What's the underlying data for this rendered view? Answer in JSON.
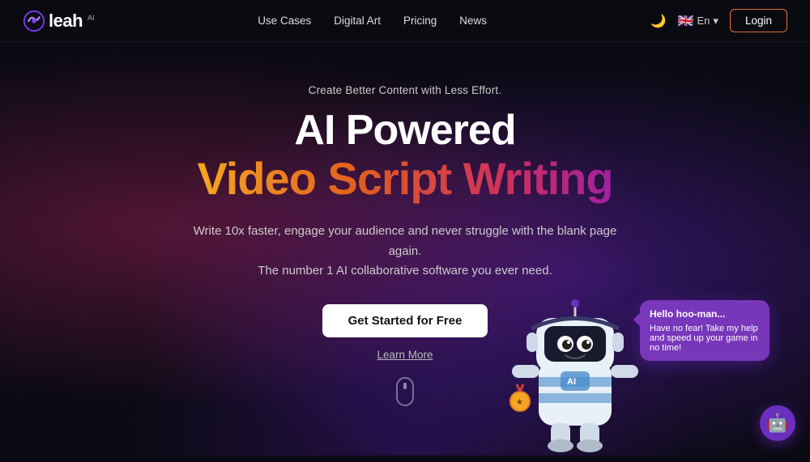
{
  "navbar": {
    "logo_text": "leah",
    "logo_badge": "AI",
    "links": [
      {
        "label": "Use Cases",
        "id": "use-cases"
      },
      {
        "label": "Digital Art",
        "id": "digital-art"
      },
      {
        "label": "Pricing",
        "id": "pricing"
      },
      {
        "label": "News",
        "id": "news"
      }
    ],
    "theme_icon": "🌙",
    "flag": "🇬🇧",
    "lang_label": "En",
    "lang_arrow": "▾",
    "login_label": "Login"
  },
  "hero": {
    "subtitle": "Create Better Content with Less Effort.",
    "title_line1": "AI Powered",
    "title_line2": "Video Script Writing",
    "description_line1": "Write 10x faster, engage your audience and never struggle with the blank page again.",
    "description_line2": "The number 1 AI collaborative software you ever need.",
    "cta_label": "Get Started for Free",
    "learn_more_label": "Learn More"
  },
  "chat_bubble": {
    "title": "Hello hoo-man...",
    "body": "Have no fear! Take my help and speed up your game in no time!"
  },
  "chat_widget": {
    "icon": "🤖"
  }
}
